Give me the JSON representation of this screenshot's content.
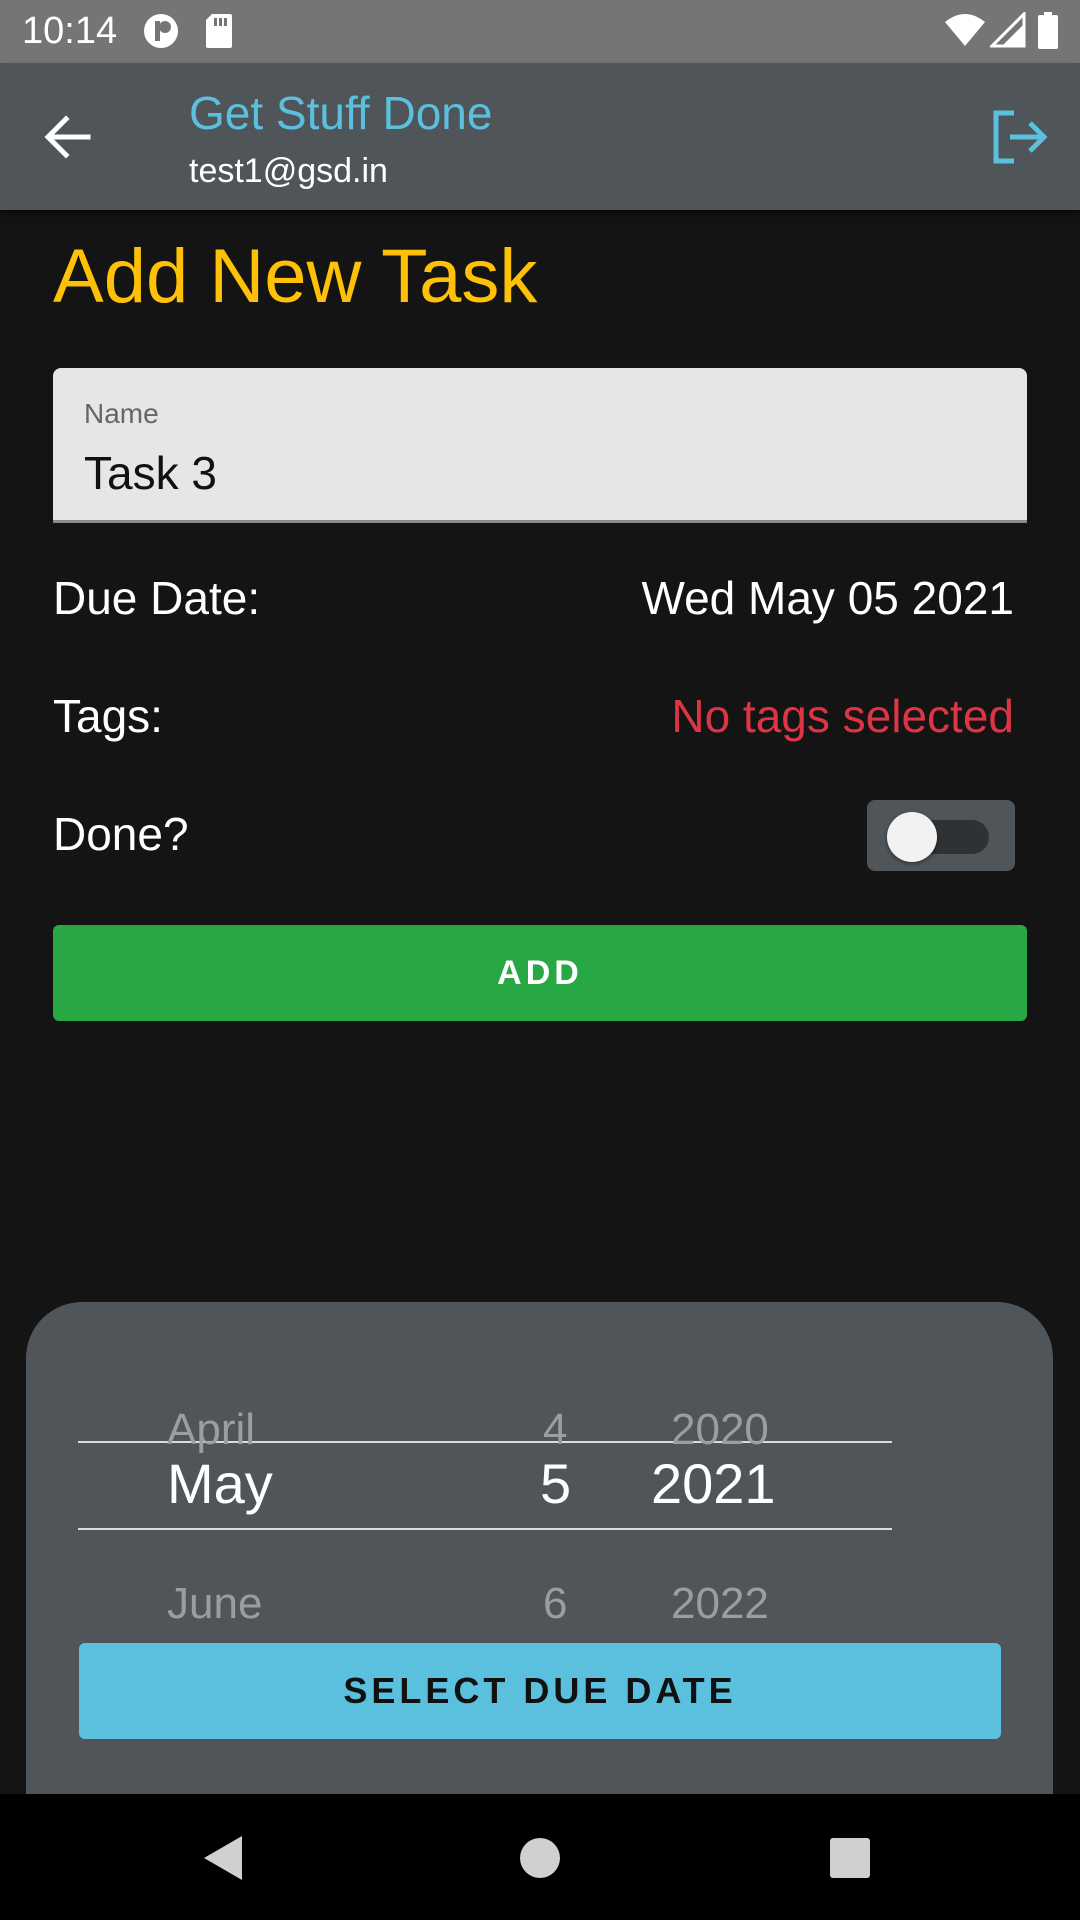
{
  "status_bar": {
    "time": "10:14"
  },
  "app_bar": {
    "title": "Get Stuff Done",
    "subtitle": "test1@gsd.in"
  },
  "page": {
    "title": "Add New Task"
  },
  "form": {
    "name_label": "Name",
    "name_value": "Task 3",
    "due_date_label": "Due Date:",
    "due_date_value": "Wed May 05 2021",
    "tags_label": "Tags:",
    "tags_value": "No tags selected",
    "done_label": "Done?",
    "done_checked": false,
    "add_button": "ADD"
  },
  "picker": {
    "months": [
      "April",
      "May",
      "June"
    ],
    "days": [
      "4",
      "5",
      "6"
    ],
    "years": [
      "2020",
      "2021",
      "2022"
    ],
    "select_button": "SELECT DUE DATE"
  },
  "colors": {
    "accent_blue": "#5bc0de",
    "title_yellow": "#ffc107",
    "add_green": "#28a745",
    "tags_red": "#dc3545"
  }
}
